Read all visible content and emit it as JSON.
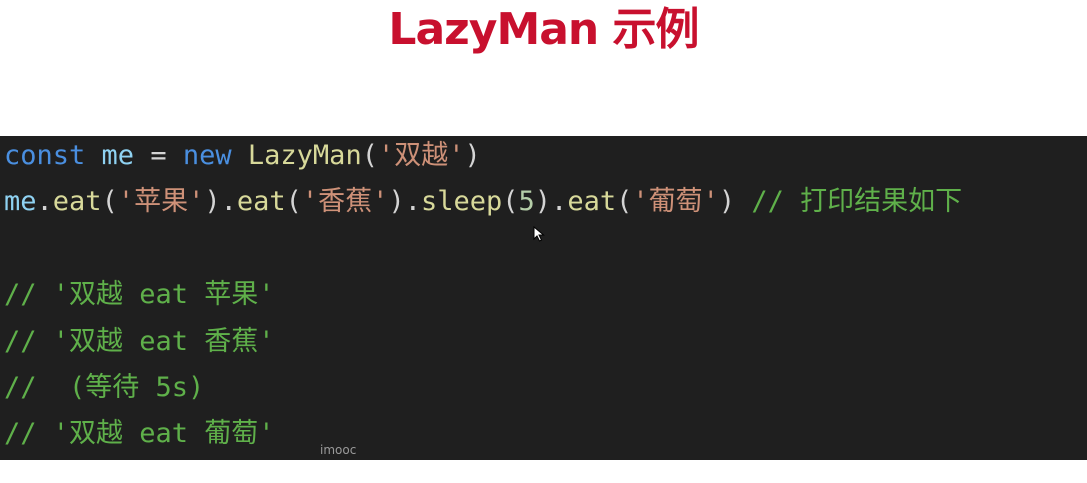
{
  "slide": {
    "title": "LazyMan 示例"
  },
  "code": {
    "line1": {
      "kw_const": "const",
      "var_me": "me",
      "op_eq": "=",
      "kw_new": "new",
      "class_name": "LazyMan",
      "paren_open": "(",
      "arg": "'双越'",
      "paren_close": ")"
    },
    "line2": {
      "var_me": "me",
      "dot1": ".",
      "m_eat1": "eat",
      "p1o": "(",
      "s1": "'苹果'",
      "p1c": ")",
      "dot2": ".",
      "m_eat2": "eat",
      "p2o": "(",
      "s2": "'香蕉'",
      "p2c": ")",
      "dot3": ".",
      "m_sleep": "sleep",
      "p3o": "(",
      "n5": "5",
      "p3c": ")",
      "dot4": ".",
      "m_eat3": "eat",
      "p4o": "(",
      "s3": "'葡萄'",
      "p4c": ")",
      "comment": "// 打印结果如下"
    },
    "comment_lines": [
      "// '双越 eat 苹果'",
      "// '双越 eat 香蕉'",
      "//  (等待 5s)",
      "// '双越 eat 葡萄'"
    ]
  },
  "watermark": "imooc",
  "colors": {
    "title": "#c8102e",
    "editor_bg": "#1f1f1f",
    "keyword": "#4a8fe0",
    "variable": "#8fd2f2",
    "class": "#d8d99a",
    "string": "#ce9178",
    "number": "#b5cea8",
    "comment": "#5fb04a"
  },
  "icons": {
    "cursor": "mouse-pointer-icon"
  }
}
